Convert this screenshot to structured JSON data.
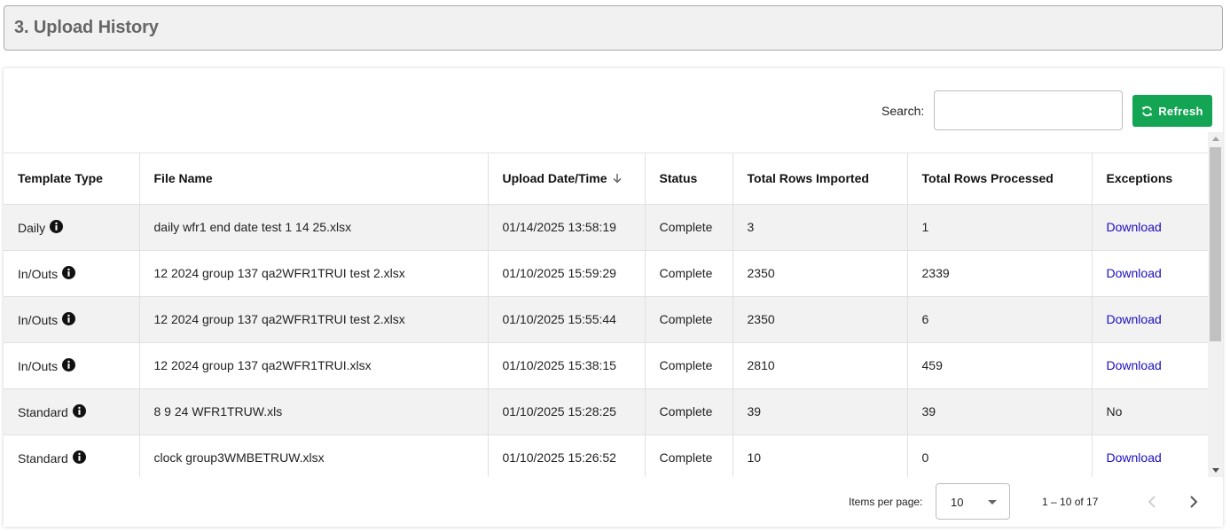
{
  "section": {
    "title": "3. Upload History"
  },
  "toolbar": {
    "search_label": "Search:",
    "search_value": "",
    "refresh_label": "Refresh",
    "refresh_icon": "refresh-icon",
    "refresh_color": "#13a553"
  },
  "table": {
    "headers": [
      "Template Type",
      "File Name",
      "Upload Date/Time",
      "Status",
      "Total Rows Imported",
      "Total Rows Processed",
      "Exceptions"
    ],
    "sorted_column": "Upload Date/Time",
    "sort_direction": "descending",
    "rows": [
      {
        "template_type": "Daily",
        "file_name": "daily wfr1 end date test 1 14 25.xlsx",
        "upload_datetime": "01/14/2025 13:58:19",
        "status": "Complete",
        "rows_imported": "3",
        "rows_processed": "1",
        "exceptions": "Download"
      },
      {
        "template_type": "In/Outs",
        "file_name": "12 2024 group 137 qa2WFR1TRUI test 2.xlsx",
        "upload_datetime": "01/10/2025 15:59:29",
        "status": "Complete",
        "rows_imported": "2350",
        "rows_processed": "2339",
        "exceptions": "Download"
      },
      {
        "template_type": "In/Outs",
        "file_name": "12 2024 group 137 qa2WFR1TRUI test 2.xlsx",
        "upload_datetime": "01/10/2025 15:55:44",
        "status": "Complete",
        "rows_imported": "2350",
        "rows_processed": "6",
        "exceptions": "Download"
      },
      {
        "template_type": "In/Outs",
        "file_name": "12 2024 group 137 qa2WFR1TRUI.xlsx",
        "upload_datetime": "01/10/2025 15:38:15",
        "status": "Complete",
        "rows_imported": "2810",
        "rows_processed": "459",
        "exceptions": "Download"
      },
      {
        "template_type": "Standard",
        "file_name": "8 9 24 WFR1TRUW.xls",
        "upload_datetime": "01/10/2025 15:28:25",
        "status": "Complete",
        "rows_imported": "39",
        "rows_processed": "39",
        "exceptions": "No"
      },
      {
        "template_type": "Standard",
        "file_name": "clock group3WMBETRUW.xlsx",
        "upload_datetime": "01/10/2025 15:26:52",
        "status": "Complete",
        "rows_imported": "10",
        "rows_processed": "0",
        "exceptions": "Download"
      }
    ]
  },
  "paginator": {
    "items_per_page_label": "Items per page:",
    "items_per_page": "10",
    "range_label": "1 – 10 of 17"
  },
  "colors": {
    "link": "#1a0dbb",
    "header_bg": "#f1f1f1",
    "stripe": "#f2f2f2"
  }
}
